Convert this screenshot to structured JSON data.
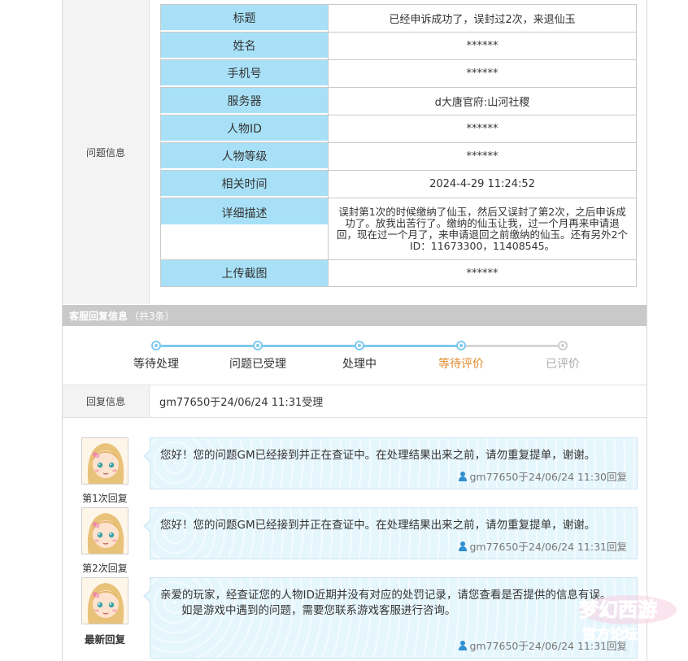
{
  "problem_info": {
    "section_label": "问题信息",
    "rows": [
      {
        "key": "标题",
        "value": "已经申诉成功了，误封过2次，来退仙玉"
      },
      {
        "key": "姓名",
        "value": "******"
      },
      {
        "key": "手机号",
        "value": "******"
      },
      {
        "key": "服务器",
        "value": "d大唐官府:山河社稷"
      },
      {
        "key": "人物ID",
        "value": "******"
      },
      {
        "key": "人物等级",
        "value": "******"
      },
      {
        "key": "相关时间",
        "value": "2024-4-29 11:24:52"
      },
      {
        "key": "详细描述",
        "value": "误封第1次的时候缴纳了仙玉，然后又误封了第2次，之后申诉成功了。放我出苦行了。缴纳的仙玉让我，过一个月再来申请退回，现在过一个月了，来申请退回之前缴纳的仙玉。还有另外2个ID：11673300，11408545。"
      },
      {
        "key": "上传截图",
        "value": "******"
      }
    ]
  },
  "reply_section": {
    "title": "客服回复信息",
    "count": "（共3条）"
  },
  "progress": {
    "steps": [
      {
        "label": "等待处理",
        "state": "done"
      },
      {
        "label": "问题已受理",
        "state": "done"
      },
      {
        "label": "处理中",
        "state": "done"
      },
      {
        "label": "等待评价",
        "state": "current"
      },
      {
        "label": "已评价",
        "state": "todo"
      }
    ],
    "colors": {
      "done": "#7fc9ee",
      "current": "#e08a2c",
      "todo": "#aaaaaa"
    }
  },
  "reply_info": {
    "label": "回复信息",
    "value": "gm77650于24/06/24 11:31受理"
  },
  "replies": [
    {
      "label": "第1次回复",
      "text": "您好！您的问题GM已经接到并正在查证中。在处理结果出来之前，请勿重复提单，谢谢。",
      "text2": "",
      "meta": "gm77650于24/06/24 11:30回复"
    },
    {
      "label": "第2次回复",
      "text": "您好！您的问题GM已经接到并正在查证中。在处理结果出来之前，请勿重复提单，谢谢。",
      "text2": "",
      "meta": "gm77650于24/06/24 11:31回复"
    },
    {
      "label": "最新回复",
      "text": "亲爱的玩家，经查证您的人物ID近期并没有对应的处罚记录，请您查看是否提供的信息有误。",
      "text2": "如是游戏中遇到的问题，需要您联系游戏客服进行咨询。",
      "meta": "gm77650于24/06/24 11:31回复"
    }
  ],
  "watermark": {
    "logo_text": "梦幻西游",
    "sub_text": "官方论坛"
  }
}
